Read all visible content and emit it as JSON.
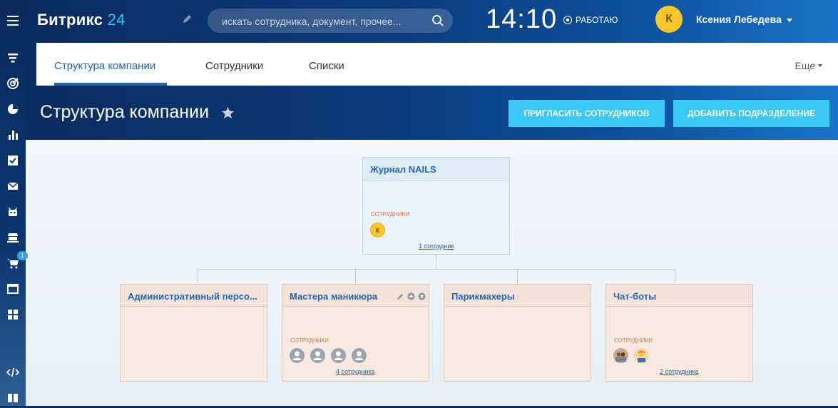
{
  "header": {
    "logo_main": "Битрикс",
    "logo_num": "24",
    "search_placeholder": "искать сотрудника, документ, прочее...",
    "clock": "14:10",
    "status": "РАБОТАЮ",
    "user_initial": "К",
    "user_name": "Ксения Лебедева"
  },
  "sidebar": {
    "icons": [
      "filter-icon",
      "target-icon",
      "pie-icon",
      "bar-chart-icon",
      "task-icon",
      "mail-icon",
      "robot-icon",
      "store-icon",
      "cart-icon",
      "window-icon",
      "grid-icon",
      "code-icon",
      "book-icon"
    ],
    "cart_badge": "1"
  },
  "tabs": {
    "items": [
      {
        "label": "Структура компании",
        "active": true
      },
      {
        "label": "Сотрудники",
        "active": false
      },
      {
        "label": "Списки",
        "active": false
      }
    ],
    "more": "Еще"
  },
  "page": {
    "title": "Структура компании",
    "invite_button": "ПРИГЛАСИТЬ СОТРУДНИКОВ",
    "add_department_button": "ДОБАВИТЬ ПОДРАЗДЕЛЕНИЕ"
  },
  "structure": {
    "root": {
      "title": "Журнал NAILS",
      "employees_label": "СОТРУДНИКИ",
      "head_initial": "К",
      "employees_link": "1 сотрудник"
    },
    "departments": [
      {
        "title": "Административный персо...",
        "employees_label": "",
        "employees_link": ""
      },
      {
        "title": "Мастера маникюра",
        "employees_label": "СОТРУДНИКИ",
        "employees_link": "4 сотрудника",
        "avatars": 4
      },
      {
        "title": "Парикмахеры",
        "employees_label": "",
        "employees_link": ""
      },
      {
        "title": "Чат-боты",
        "employees_label": "СОТРУДНИКИ",
        "employees_link": "2 сотрудника",
        "avatars": 2
      }
    ]
  }
}
